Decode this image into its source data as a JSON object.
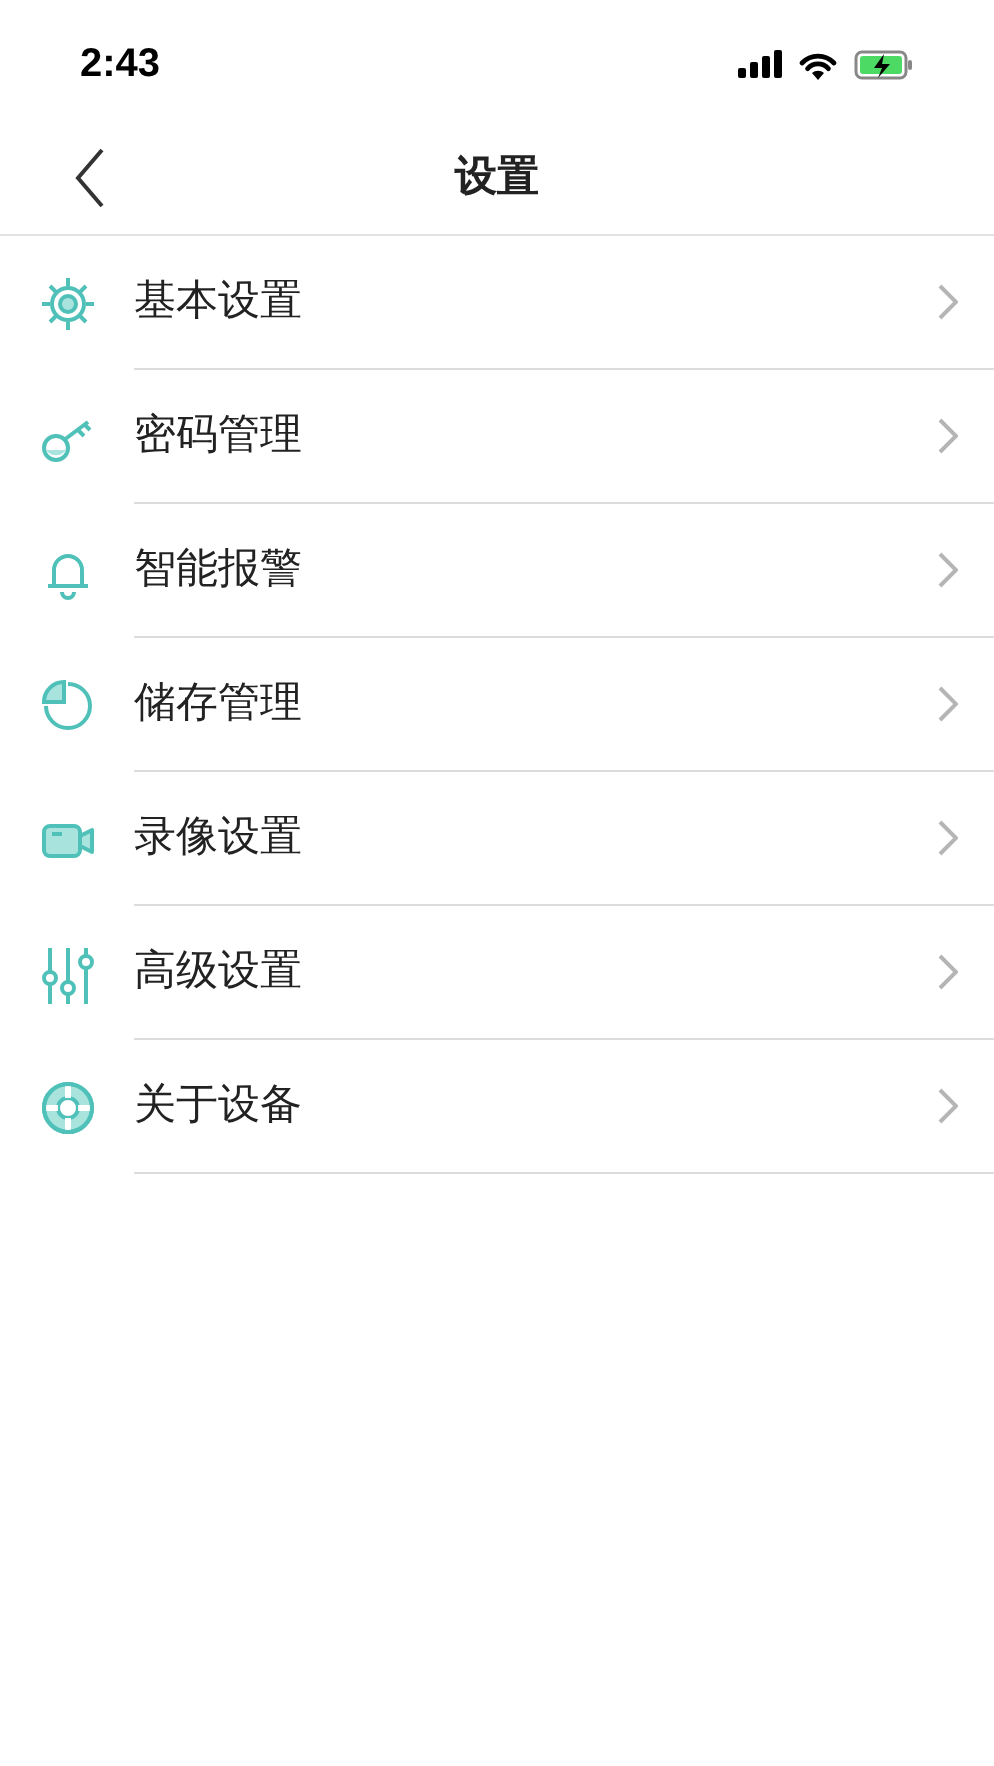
{
  "status_bar": {
    "time": "2:43"
  },
  "nav": {
    "title": "设置"
  },
  "items": [
    {
      "kind": "gear",
      "label": "基本设置"
    },
    {
      "kind": "key",
      "label": "密码管理"
    },
    {
      "kind": "bell",
      "label": "智能报警"
    },
    {
      "kind": "pie",
      "label": "储存管理"
    },
    {
      "kind": "camera",
      "label": "录像设置"
    },
    {
      "kind": "sliders",
      "label": "高级设置"
    },
    {
      "kind": "lifebuoy",
      "label": "关于设备"
    }
  ]
}
